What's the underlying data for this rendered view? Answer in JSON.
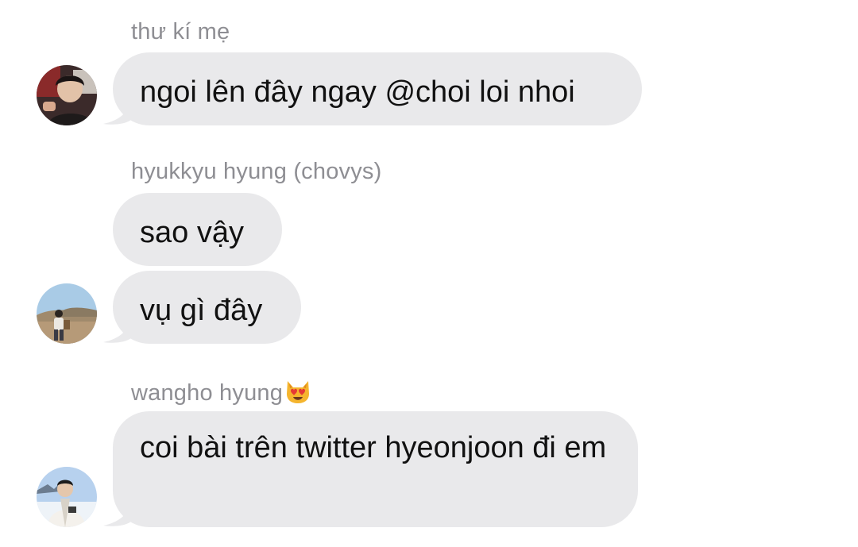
{
  "messages": [
    {
      "sender": "thư kí mẹ",
      "bubbles": [
        "ngoi lên đây ngay @choi loi nhoi"
      ],
      "avatar_icon": "profile-photo-icon"
    },
    {
      "sender": "hyukkyu hyung (chovys)",
      "bubbles": [
        "sao vậy",
        "vụ gì đây"
      ],
      "avatar_icon": "profile-photo-icon"
    },
    {
      "sender": "wangho hyung",
      "sender_emoji": "heart-eyes-cat-emoji",
      "bubbles": [
        "coi bài trên twitter hyeonjoon đi em"
      ],
      "avatar_icon": "profile-photo-icon"
    }
  ],
  "colors": {
    "bubble_bg": "#e9e9eb",
    "sender_text": "#8e8e93",
    "message_text": "#111111"
  }
}
